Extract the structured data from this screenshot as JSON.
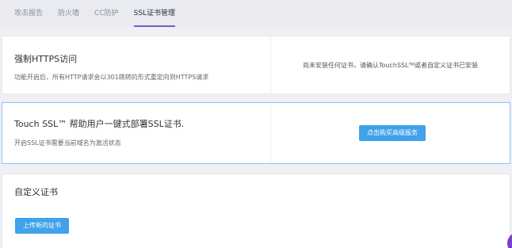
{
  "tabs": [
    {
      "label": "攻击报告"
    },
    {
      "label": "防火墙"
    },
    {
      "label": "CC防护"
    },
    {
      "label": "SSL证书管理"
    }
  ],
  "https_card": {
    "title": "强制HTTPS访问",
    "description": "功能开启后，所有HTTP请求会以301跳转的形式重定向到HTTPS请求",
    "status_prefix": "尚未安装任何证书，请确认TouchSSL",
    "status_tm": "TM",
    "status_suffix": "或者自定义证书已安装"
  },
  "touchssl_card": {
    "title": "Touch SSL™ 帮助用户一键式部署SSL证书.",
    "description": "开启SSL证书需要当前域名为激活状态",
    "button_label": "点击购买高级服务"
  },
  "custom_card": {
    "title": "自定义证书",
    "button_label": "上传新的证书"
  },
  "colors": {
    "accent": "#7b5cc5",
    "button": "#3fa2ea",
    "highlight_border": "#8ec3ef"
  }
}
